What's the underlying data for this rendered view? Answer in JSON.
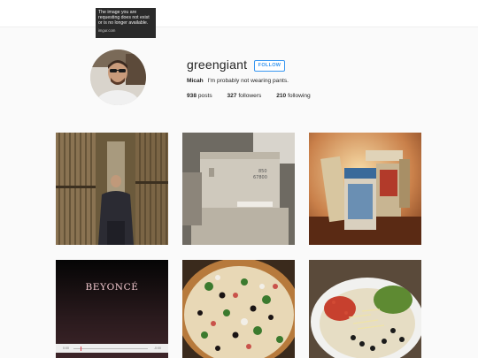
{
  "broken_image": {
    "message": "The image you are requesting does not exist or is no longer available.",
    "source": "imgur.com"
  },
  "profile": {
    "username": "greengiant",
    "follow_label": "FOLLOW",
    "name": "Micah",
    "bio": "I'm probably not wearing pants.",
    "posts_count": "938",
    "posts_label": "posts",
    "followers_count": "327",
    "followers_label": "followers",
    "following_count": "210",
    "following_label": "following"
  },
  "posts": [
    {
      "label": "record-store-photo"
    },
    {
      "label": "boxes-photo"
    },
    {
      "label": "cereal-boxes-photo"
    },
    {
      "label": "beyonce-album-photo",
      "title": "BEYONCÉ",
      "time_start": "0:00",
      "time_end": "-0:00"
    },
    {
      "label": "pizza-photo"
    },
    {
      "label": "burrito-bowl-photo"
    }
  ],
  "colors": {
    "accent": "#3897f0",
    "background": "#fafafa"
  }
}
